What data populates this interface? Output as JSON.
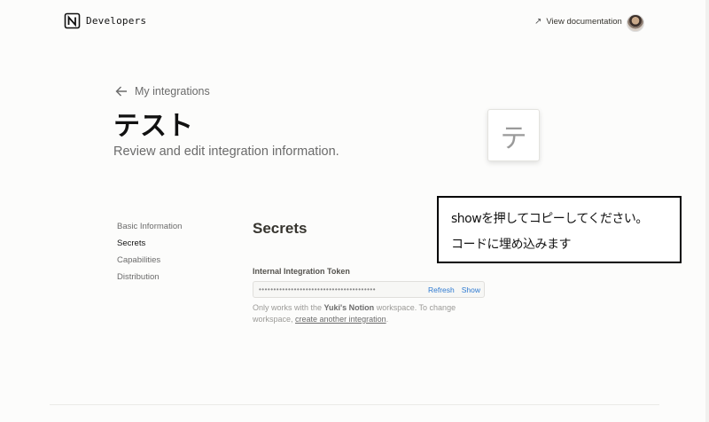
{
  "header": {
    "brand": "Developers",
    "view_docs_label": "View documentation",
    "logo_icon": "notion-logo-icon",
    "avatar": "user-avatar"
  },
  "page": {
    "back_label": "My integrations",
    "title": "テスト",
    "subtitle": "Review and edit integration information.",
    "icon_glyph": "テ"
  },
  "sidebar": {
    "items": [
      {
        "label": "Basic Information",
        "active": false
      },
      {
        "label": "Secrets",
        "active": true
      },
      {
        "label": "Capabilities",
        "active": false
      },
      {
        "label": "Distribution",
        "active": false
      }
    ]
  },
  "secrets": {
    "heading": "Secrets",
    "token_label": "Internal Integration Token",
    "token_mask": "••••••••••••••••••••••••••••••••••••••••",
    "refresh_label": "Refresh",
    "show_label": "Show",
    "helper_prefix": "Only works with the ",
    "workspace_name": "Yuki's Notion",
    "helper_middle": " workspace. To change workspace, ",
    "helper_link": "create another integration",
    "helper_suffix": "."
  },
  "annotation": {
    "line1": "showを押してコピーしてください。",
    "line2": "コードに埋め込みます"
  },
  "colors": {
    "accent": "#2e7ad1",
    "text": "#37352f",
    "muted": "#6b6b6b",
    "background": "#fcfcfb"
  }
}
